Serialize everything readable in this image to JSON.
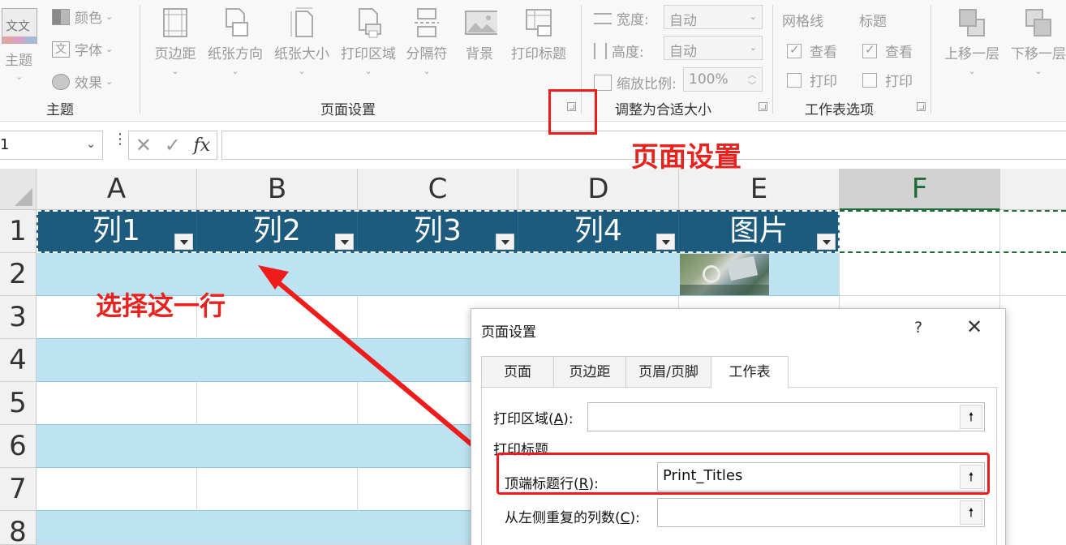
{
  "ribbon": {
    "theme_group": {
      "themes_label": "主题",
      "colors_label": "颜色",
      "fonts_label": "字体",
      "effects_label": "效果",
      "group_label": "主题",
      "theme_icon_text": "文文"
    },
    "page_setup_group": {
      "buttons": [
        "页边距",
        "纸张方向",
        "纸张大小",
        "打印区域",
        "分隔符",
        "背景",
        "打印标题"
      ],
      "group_label": "页面设置"
    },
    "scale_group": {
      "width_label": "宽度:",
      "width_value": "自动",
      "height_label": "高度:",
      "height_value": "自动",
      "scale_label": "缩放比例:",
      "scale_value": "100%",
      "group_label": "调整为合适大小"
    },
    "sheet_options_group": {
      "gridlines_label": "网格线",
      "headings_label": "标题",
      "view_label": "查看",
      "print_label": "打印",
      "group_label": "工作表选项"
    },
    "arrange_group": {
      "bring_forward": "上移一层",
      "send_backward": "下移一层"
    }
  },
  "formula_bar": {
    "name_box": "1",
    "formula": ""
  },
  "grid": {
    "columns": [
      "A",
      "B",
      "C",
      "D",
      "E",
      "F"
    ],
    "rows": [
      "1",
      "2",
      "3",
      "4",
      "5",
      "6",
      "7",
      "8"
    ],
    "headers": [
      "列1",
      "列2",
      "列3",
      "列4",
      "图片"
    ]
  },
  "annotations": {
    "page_setup": "页面设置",
    "select_row": "选择这一行"
  },
  "dialog": {
    "title": "页面设置",
    "help": "?",
    "close": "✕",
    "tabs": [
      "页面",
      "页边距",
      "页眉/页脚",
      "工作表"
    ],
    "active_tab": "工作表",
    "print_area_label_prefix": "打印区域(",
    "print_area_key": "A",
    "print_area_label_suffix": "):",
    "print_area_value": "",
    "print_titles_label": "打印标题",
    "rows_repeat_label_prefix": "顶端标题行(",
    "rows_repeat_key": "R",
    "rows_repeat_label_suffix": "):",
    "rows_repeat_value": "Print_Titles",
    "cols_repeat_label_prefix": "从左侧重复的列数(",
    "cols_repeat_key": "C",
    "cols_repeat_label_suffix": "):",
    "cols_repeat_value": ""
  },
  "colors": {
    "header_fill": "#1c5a7e",
    "band_fill": "#bde3f2",
    "annotation_red": "#e8231f",
    "selected_col": "#1d6b38"
  }
}
